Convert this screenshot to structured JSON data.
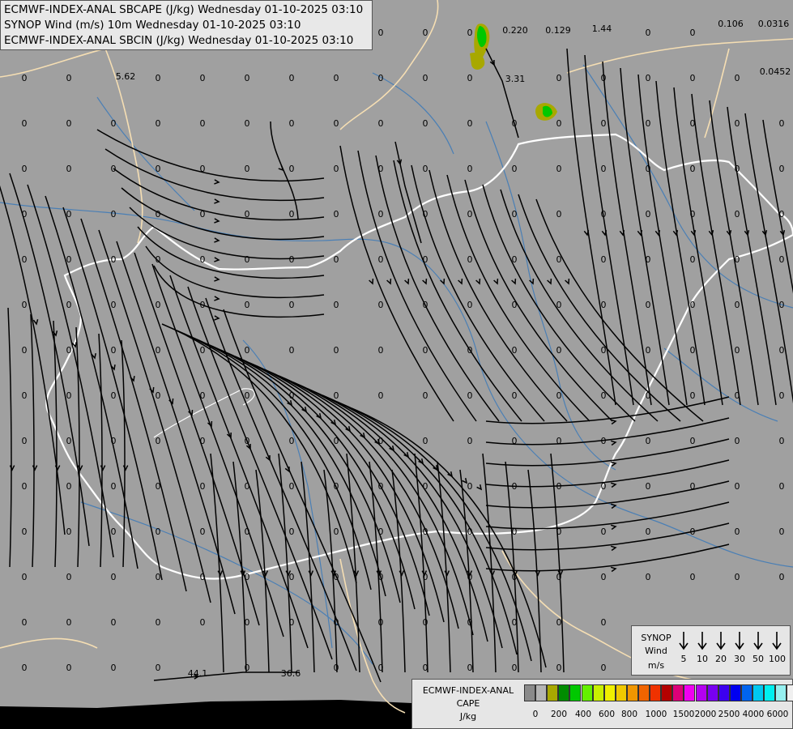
{
  "titles": [
    "ECMWF-INDEX-ANAL SBCAPE (J/kg) Wednesday 01-10-2025 03:10",
    "SYNOP Wind (m/s) 10m Wednesday 01-10-2025 03:10",
    "ECMWF-INDEX-ANAL SBCIN (J/kg) Wednesday 01-10-2025 03:10"
  ],
  "synop_legend": {
    "title_lines": [
      "SYNOP",
      "Wind",
      "m/s"
    ],
    "speeds": [
      "5",
      "10",
      "20",
      "30",
      "50",
      "100"
    ]
  },
  "cape_legend": {
    "title_lines": [
      "ECMWF-INDEX-ANAL",
      "CAPE",
      "J/kg"
    ],
    "colors": [
      "#8a8a8a",
      "#b4b4b4",
      "#a8a800",
      "#008c00",
      "#00c800",
      "#64f000",
      "#c8f000",
      "#f0f000",
      "#f0c800",
      "#f09600",
      "#f06400",
      "#f03200",
      "#b40000",
      "#dc0078",
      "#f000f0",
      "#b400f0",
      "#7800f0",
      "#3c00f0",
      "#0000f0",
      "#0064f0",
      "#00c8f0",
      "#00f0f0",
      "#96f0f0",
      "#f0f0f0"
    ],
    "labels": [
      "0",
      "200",
      "400",
      "600",
      "800",
      "1000",
      "1500",
      "2000",
      "2500",
      "4000",
      "6000"
    ]
  },
  "cin_values": [
    "0",
    "0.220",
    "0.129",
    "1.44",
    "0.106",
    "0.0316",
    "5.62",
    "3.31",
    "0.0452",
    "44.1",
    "36.6"
  ],
  "colors": {
    "background": "#a0a0a0",
    "border": "#f5deb3",
    "country_border": "#ffffff",
    "river": "#4a7fb5",
    "streamline": "#000000"
  }
}
